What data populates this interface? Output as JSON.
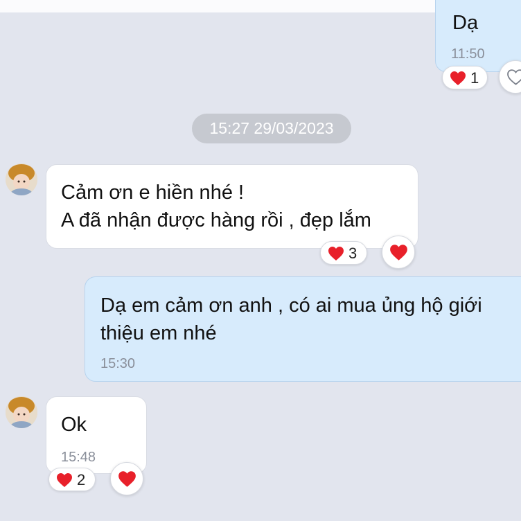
{
  "colors": {
    "background": "#e2e5ee",
    "incoming_bubble": "#ffffff",
    "outgoing_bubble": "#d7ebfc",
    "heart": "#e8202a",
    "timestamp": "#8a8f9a"
  },
  "date_separator": "15:27 29/03/2023",
  "messages": [
    {
      "id": "m1",
      "direction": "outgoing",
      "text": "Dạ",
      "time": "11:50",
      "reaction": {
        "icon": "heart-icon",
        "count": "1"
      },
      "react_button_icon": "heart-outline-icon"
    },
    {
      "id": "m2",
      "direction": "incoming",
      "text": "Cảm ơn e hiền nhé !\nA đã nhận được hàng rồi , đẹp lắm",
      "reaction": {
        "icon": "heart-icon",
        "count": "3"
      },
      "react_button_icon": "heart-icon"
    },
    {
      "id": "m3",
      "direction": "outgoing",
      "text": "Dạ em cảm ơn anh , có ai mua ủng hộ giới\nthiệu em nhé",
      "time": "15:30"
    },
    {
      "id": "m4",
      "direction": "incoming",
      "text": "Ok",
      "time": "15:48",
      "reaction": {
        "icon": "heart-icon",
        "count": "2"
      },
      "react_button_icon": "heart-icon"
    }
  ]
}
